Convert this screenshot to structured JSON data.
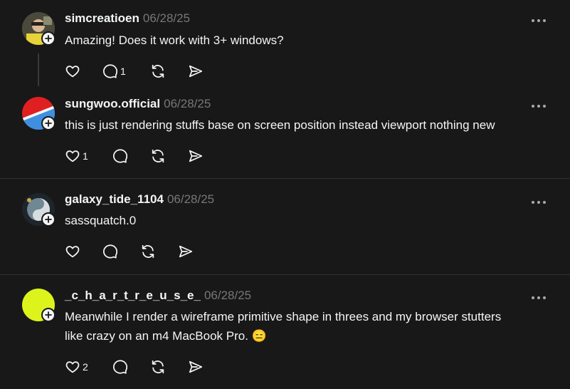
{
  "posts": [
    {
      "username": "simcreatioen",
      "date": "06/28/25",
      "lines": [
        "Amazing! Does it work with 3+ windows?"
      ],
      "likes": "",
      "replies": "1",
      "avatar_color": "#6b6b5a"
    },
    {
      "username": "sungwoo.official",
      "date": "06/28/25",
      "lines": [
        "this is just rendering stuffs base on screen position instead viewport nothing new"
      ],
      "likes": "1",
      "replies": "",
      "avatar_color": "#e02020"
    },
    {
      "username": "galaxy_tide_1104",
      "date": "06/28/25",
      "lines": [
        "sassquatch.0"
      ],
      "likes": "",
      "replies": "",
      "avatar_color": "#2a3a44"
    },
    {
      "username": "_c_h_a_r_t_r_e_u_s_e_",
      "date": "06/28/25",
      "lines": [
        "Meanwhile I render a wireframe primitive shape in threes and my browser stutters",
        "like crazy on an m4 MacBook Pro. 😑"
      ],
      "likes": "2",
      "replies": "",
      "avatar_color": "#dcf41b"
    }
  ],
  "icons": {
    "like": "heart-icon",
    "reply": "comment-icon",
    "repost": "repost-icon",
    "share": "send-icon",
    "more": "more-icon",
    "follow": "plus-icon"
  },
  "colors": {
    "background": "#181818",
    "text": "#f3f5f7",
    "muted": "#777777",
    "divider": "#323232"
  }
}
